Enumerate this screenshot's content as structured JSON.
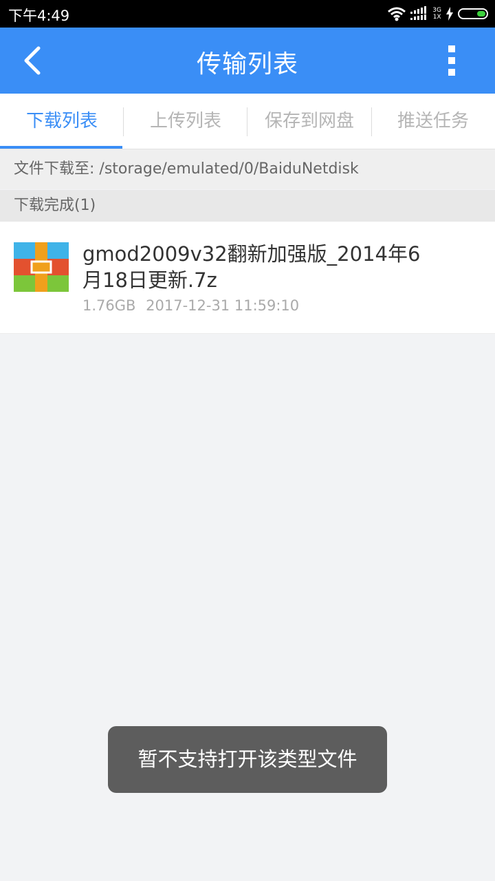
{
  "status_bar": {
    "time": "下午4:49",
    "network_top": "3G",
    "network_bottom": "1X"
  },
  "appbar": {
    "title": "传输列表"
  },
  "tabs": [
    {
      "label": "下载列表",
      "active": true
    },
    {
      "label": "上传列表",
      "active": false
    },
    {
      "label": "保存到网盘",
      "active": false
    },
    {
      "label": "推送任务",
      "active": false
    }
  ],
  "download_path": "文件下载至: /storage/emulated/0/BaiduNetdisk",
  "section_header": "下载完成(1)",
  "files": [
    {
      "name": "gmod2009v32翻新加强版_2014年6月18日更新.7z",
      "size": "1.76GB",
      "datetime": "2017-12-31 11:59:10",
      "icon": "archive-icon"
    }
  ],
  "toast": "暂不支持打开该类型文件",
  "colors": {
    "accent": "#3a8ef6",
    "toast_bg": "#5d5d5d"
  }
}
